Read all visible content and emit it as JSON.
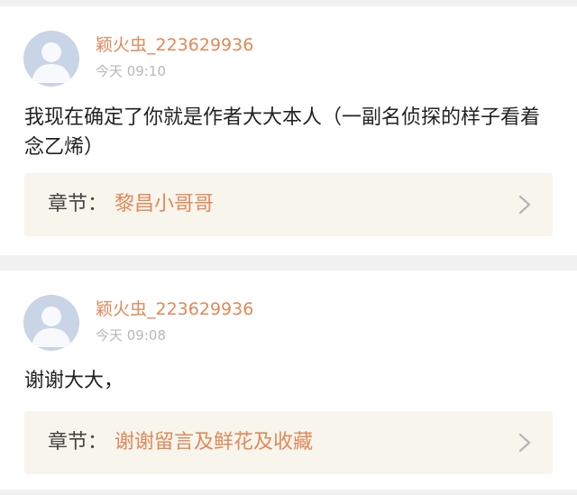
{
  "comments": [
    {
      "username": "颖火虫_223629936",
      "timestamp": "今天 09:10",
      "text": "我现在确定了你就是作者大大本人（一副名侦探的样子看着念乙烯）",
      "chapter_prefix": "章节：",
      "chapter_title": "黎昌小哥哥"
    },
    {
      "username": "颖火虫_223629936",
      "timestamp": "今天 09:08",
      "text": "谢谢大大，",
      "chapter_prefix": "章节：",
      "chapter_title": "谢谢留言及鲜花及收藏"
    }
  ],
  "colors": {
    "accent": "#e0895a",
    "timestamp": "#b8b8b8",
    "text": "#222222",
    "chapter_bg": "#f7f5ec",
    "page_bg": "#f1f1f1",
    "avatar_bg": "#c9d4e6"
  },
  "icons": {
    "avatar": "default-user-avatar",
    "chevron": "chevron-right-icon"
  }
}
